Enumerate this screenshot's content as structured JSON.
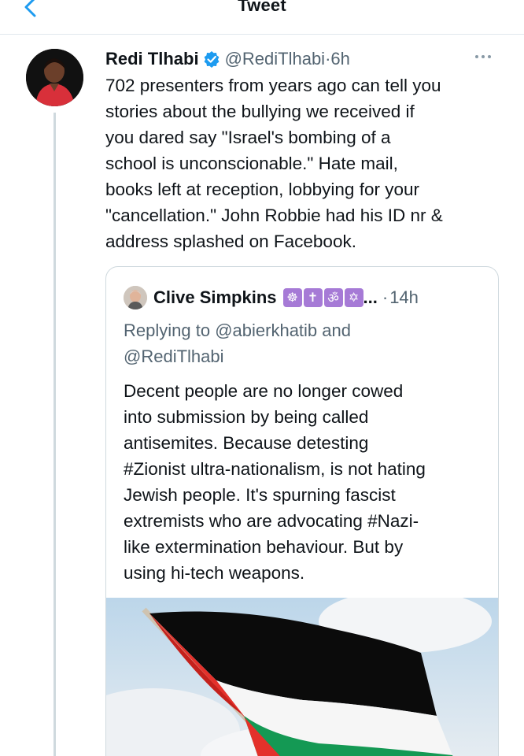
{
  "header": {
    "title": "Tweet"
  },
  "tweet": {
    "name": "Redi Tlhabi",
    "handle": "@RediTlhabi",
    "dot": "·",
    "time": "6h",
    "lines": [
      "702 presenters from years ago can tell you",
      "stories about the bullying we received if",
      "you dared say \"Israel's bombing of a",
      "school is unconscionable.\"  Hate mail,",
      "books left at reception, lobbying for your",
      "\"cancellation.\" John Robbie had his ID nr &",
      "address splashed on Facebook."
    ]
  },
  "quote": {
    "name": "Clive Simpkins",
    "emojis": [
      "☸",
      "✝",
      "ॐ",
      "✡"
    ],
    "ellipsis": "...",
    "dot": "·",
    "time": "14h",
    "reply_prefix": "Replying to",
    "reply_mention_1": "@abierkhatib",
    "reply_and": "and",
    "reply_mention_2": "@RediTlhabi",
    "lines": [
      "Decent people are no longer cowed",
      "into submission by being called",
      "antisemites. Because detesting",
      "#Zionist ultra-nationalism, is not hating",
      "Jewish people. It's spurning fascist",
      "extremists who are advocating #Nazi-",
      "like extermination behaviour. But by",
      "using hi-tech weapons."
    ]
  },
  "colors": {
    "accent": "#1d9bf0",
    "secondary_text": "#536471",
    "flag_red": "#e4312b",
    "flag_green": "#149954",
    "flag_black": "#000000"
  },
  "icons": {
    "back": "chevron-left-icon",
    "verified": "verified-badge-icon",
    "more": "more-dots-icon"
  }
}
